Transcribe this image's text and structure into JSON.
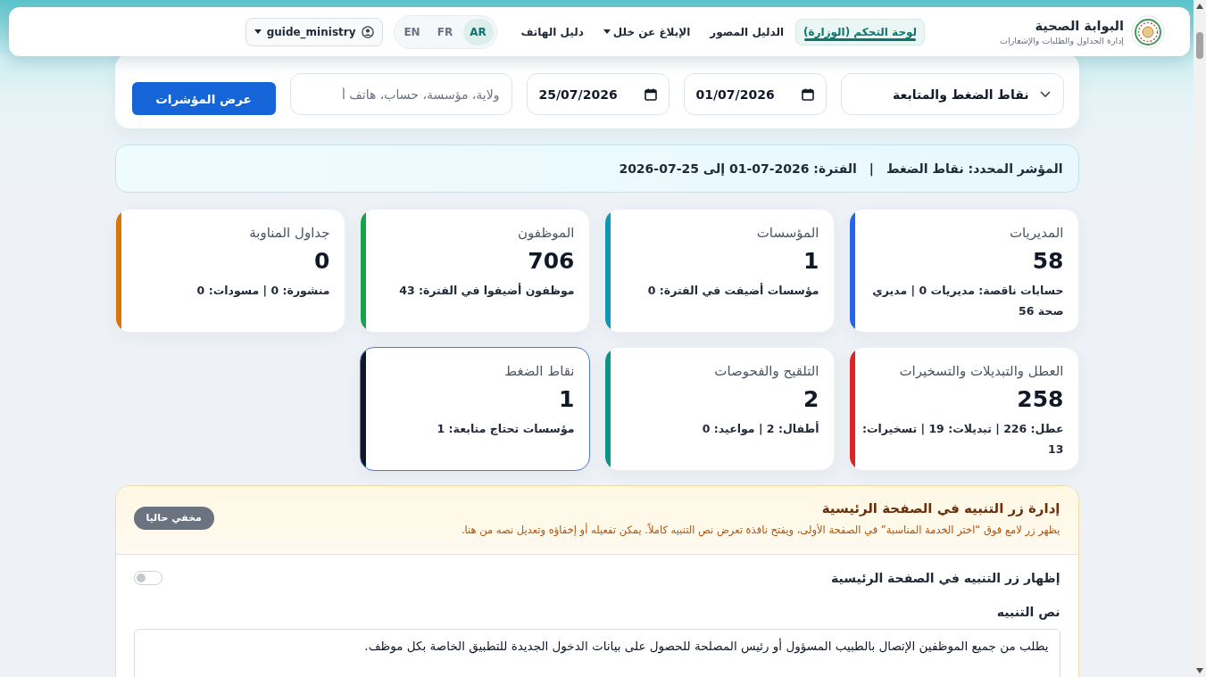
{
  "header": {
    "logo_title": "البوابة الصحية",
    "logo_subtitle": "إدارة الجداول والطلبات والإشعارات",
    "nav": [
      {
        "label": "لوحة التحكم (الوزارة)",
        "selected": true,
        "dropdown": false
      },
      {
        "label": "الدليل المصور",
        "selected": false,
        "dropdown": false
      },
      {
        "label": "الإبلاغ عن خلل",
        "selected": false,
        "dropdown": true
      },
      {
        "label": "دليل الهاتف",
        "selected": false,
        "dropdown": false
      }
    ],
    "languages": [
      {
        "label": "AR",
        "selected": true
      },
      {
        "label": "FR",
        "selected": false
      },
      {
        "label": "EN",
        "selected": false
      }
    ],
    "user": {
      "name": "guide_ministry"
    }
  },
  "filters": {
    "indicator": {
      "value": "نقاط الضغط والمتابعة"
    },
    "date_from": {
      "value": "01/07/2026"
    },
    "date_to": {
      "value": "25/07/2026"
    },
    "search": {
      "placeholder": "ولاية، مؤسسة، حساب، هاتف أ"
    },
    "submit_button": "عرض المؤشرات"
  },
  "summary": {
    "indicator": "المؤشر المحدد: نقاط الضغط",
    "separator": "|",
    "period": "الفترة: 2026-07-01 إلى 25-07-2026"
  },
  "cards": [
    {
      "title": "المديريات",
      "value": "58",
      "note": "حسابات ناقصة: مديريات 0 | مديري صحة 56",
      "color": "#2563eb",
      "selected": false
    },
    {
      "title": "المؤسسات",
      "value": "1",
      "note": "مؤسسات أضيفت في الفترة: 0",
      "color": "#0e97b5",
      "selected": false
    },
    {
      "title": "الموظفون",
      "value": "706",
      "note": "موظفون أضيفوا في الفترة: 43",
      "color": "#16a34a",
      "selected": false
    },
    {
      "title": "جداول المناوبة",
      "value": "0",
      "note": "منشورة: 0 | مسودات: 0",
      "color": "#d97706",
      "selected": false
    },
    {
      "title": "العطل والتبديلات والتسخيرات",
      "value": "258",
      "note": "عطل: 226 | تبديلات: 19 | تسخيرات: 13",
      "color": "#dc2626",
      "selected": false
    },
    {
      "title": "التلقيح والفحوصات",
      "value": "2",
      "note": "أطفال: 2 | مواعيد: 0",
      "color": "#0d9488",
      "selected": false
    },
    {
      "title": "نقاط الضغط",
      "value": "1",
      "note": "مؤسسات تحتاج متابعة: 1",
      "color": "#0f172a",
      "selected": true
    }
  ],
  "alert_settings": {
    "title": "إدارة زر التنبيه في الصفحة الرئيسية",
    "description": "يظهر زر لامع فوق “اختر الخدمة المناسبة” في الصفحة الأولى، ويفتح نافذة تعرض نص التنبيه كاملاً. يمكن تفعيله أو إخفاؤه وتعديل نصه من هنا.",
    "badge": "مخفي حاليا",
    "toggle": {
      "label": "إظهار زر التنبيه في الصفحة الرئيسية",
      "on": false
    },
    "message": {
      "label": "نص التنبيه",
      "value": "يطلب من جميع الموظفين الإتصال بالطبيب المسؤول أو رئيس المصلحة للحصول على بيانات الدخول الجديدة للتطبيق الخاصة بكل موظف."
    }
  }
}
